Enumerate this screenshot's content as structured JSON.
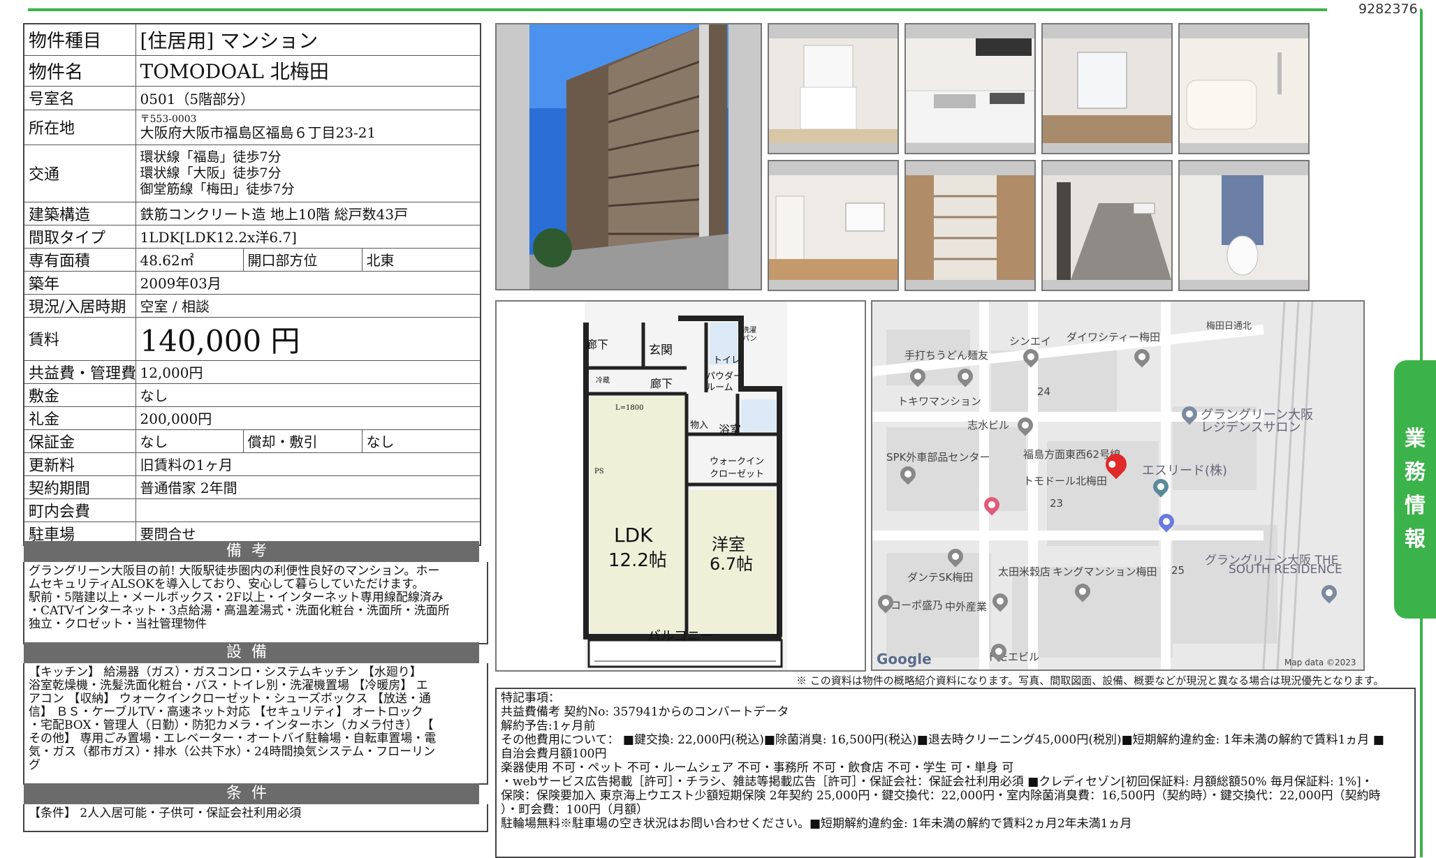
{
  "doc_id": "9282376",
  "side_tab": [
    "業",
    "務",
    "情",
    "報"
  ],
  "property": {
    "type_label": "物件種目",
    "type_value": "[住居用] マンション",
    "name_label": "物件名",
    "name_value": "TOMODOAL 北梅田",
    "room_label": "号室名",
    "room_value": "0501（5階部分）",
    "address_label": "所在地",
    "postal": "〒553-0003",
    "address": "大阪府大阪市福島区福島６丁目23-21",
    "transport_label": "交通",
    "transport": [
      "環状線「福島」徒歩7分",
      "環状線「大阪」徒歩7分",
      "御堂筋線「梅田」徒歩7分"
    ],
    "structure_label": "建築構造",
    "structure_value": "鉄筋コンクリート造 地上10階 総戸数43戸",
    "layout_label": "間取タイプ",
    "layout_value": "1LDK[LDK12.2x洋6.7]",
    "area_label": "専有面積",
    "area_value": "48.62㎡",
    "direction_label": "開口部方位",
    "direction_value": "北東",
    "built_label": "築年",
    "built_value": "2009年03月",
    "status_label": "現況/入居時期",
    "status_value": "空室 / 相談",
    "rent_label": "賃料",
    "rent_value": "140,000 円",
    "fee_label": "共益費・管理費",
    "fee_value": "12,000円",
    "deposit_label": "敷金",
    "deposit_value": "なし",
    "key_money_label": "礼金",
    "key_money_value": "200,000円",
    "guarantee_label": "保証金",
    "guarantee_value": "なし",
    "amort_label": "償却・敷引",
    "amort_value": "なし",
    "renewal_label": "更新料",
    "renewal_value": "旧賃料の1ヶ月",
    "contract_label": "契約期間",
    "contract_value": "普通借家 2年間",
    "community_label": "町内会費",
    "community_value": "",
    "parking_label": "駐車場",
    "parking_value": "要問合せ"
  },
  "remarks": {
    "head": "備考",
    "text": [
      "グラングリーン大阪目の前! 大阪駅徒歩圏内の利便性良好のマンション。ホー",
      "ムセキュリティALSOKを導入しており、安心して暮らしていただけます。",
      "駅前・5階建以上・メールボックス・2F以上・インターネット専用線配線済み",
      "・CATVインターネット・3点給湯・高温差湯式・洗面化粧台・洗面所・洗面所",
      "独立・クロゼット・当社管理物件"
    ]
  },
  "equipment": {
    "head": "設備",
    "text": [
      "【キッチン】 給湯器（ガス）・ガスコンロ・システムキッチン 【水廻り】",
      "浴室乾燥機・洗髪洗面化粧台・バス・トイレ別・洗濯機置場 【冷暖房】 エ",
      "アコン 【収納】 ウォークインクローゼット・シューズボックス 【放送・通",
      "信】 ＢＳ・ケーブルTV・高速ネット対応 【セキュリティ】 オートロック",
      "・宅配BOX・管理人（日勤）・防犯カメラ・インターホン（カメラ付き） 【",
      "その他】 専用ごみ置場・エレベーター・オートバイ駐輪場・自転車置場・電",
      "気・ガス（都市ガス）・排水（公共下水）・24時間換気システム・フローリン",
      "グ"
    ]
  },
  "conditions": {
    "head": "条件",
    "text": "【条件】 2人入居可能・子供可・保証会社利用必須"
  },
  "floorplan": {
    "hall1": "廊下",
    "entrance": "玄関",
    "toilet": "トイレ",
    "washer": "洗濯パン",
    "hall2": "廊下",
    "powder": "パウダールーム",
    "closet_small": "物入",
    "bath": "浴室",
    "walkin1": "ウォークイン",
    "walkin2": "クローゼット",
    "ldk": "LDK",
    "ldk_size": "12.2帖",
    "western": "洋室",
    "western_size": "6.7帖",
    "balcony": "バルコニー",
    "fridge": "冷蔵",
    "ps": "PS",
    "kitchen_len": "L=1800"
  },
  "map": {
    "labels": [
      "梅田日通北",
      "シンエイ",
      "ダイワシティー梅田",
      "手打ちうどん麺友",
      "24",
      "トキワマンション",
      "志水ビル",
      "グラングリーン大阪",
      "レジデンスサロン",
      "SPK外車部品センター",
      "福島方面東西62号線",
      "エスリード(株)",
      "トモドール北梅田",
      "23",
      "グラングリーン大阪 THE",
      "SOUTH RESIDENCE",
      "ダンテSK梅田",
      "太田米穀店",
      "キングマンション梅田",
      "25",
      "コーポ盛乃",
      "中外産業",
      "トモエビル",
      "Google",
      "Map data ©2023"
    ]
  },
  "disclaimer": "※ この資料は物件の概略紹介資料になります。写真、間取図面、設備、概要などが現況と異なる場合は現況優先となります。",
  "notes": [
    "特記事項：",
    "共益費備考 契約No: 357941からのコンバートデータ",
    "解約予告:1ヶ月前",
    "その他費用について： ■鍵交換: 22,000円(税込)■除菌消臭: 16,500円(税込)■退去時クリーニング45,000円(税別)■短期解約違約金: 1年未満の解約で賃料1ヵ月 ■",
    "自治会費月額100円",
    "楽器使用 不可・ペット 不可・ルームシェア 不可・事務所 不可・飲食店 不可・学生 可・単身 可",
    "・webサービス広告掲載［許可］・チラシ、雑誌等掲載広告［許可］・保証会社：保証会社利用必須 ■クレディセゾン[初回保証料: 月額総額50% 毎月保証料: 1%]・",
    "保険：保険要加入 東京海上ウエスト少額短期保険 2年契約 25,000円・鍵交換代：22,000円・室内除菌消臭費：16,500円（契約時）・鍵交換代：22,000円（契約時",
    "）・町会費：100円（月額）",
    "駐輪場無料※駐車場の空き状況はお問い合わせください。■短期解約違約金: 1年未満の解約で賃料2ヵ月2年未満1ヵ月"
  ]
}
